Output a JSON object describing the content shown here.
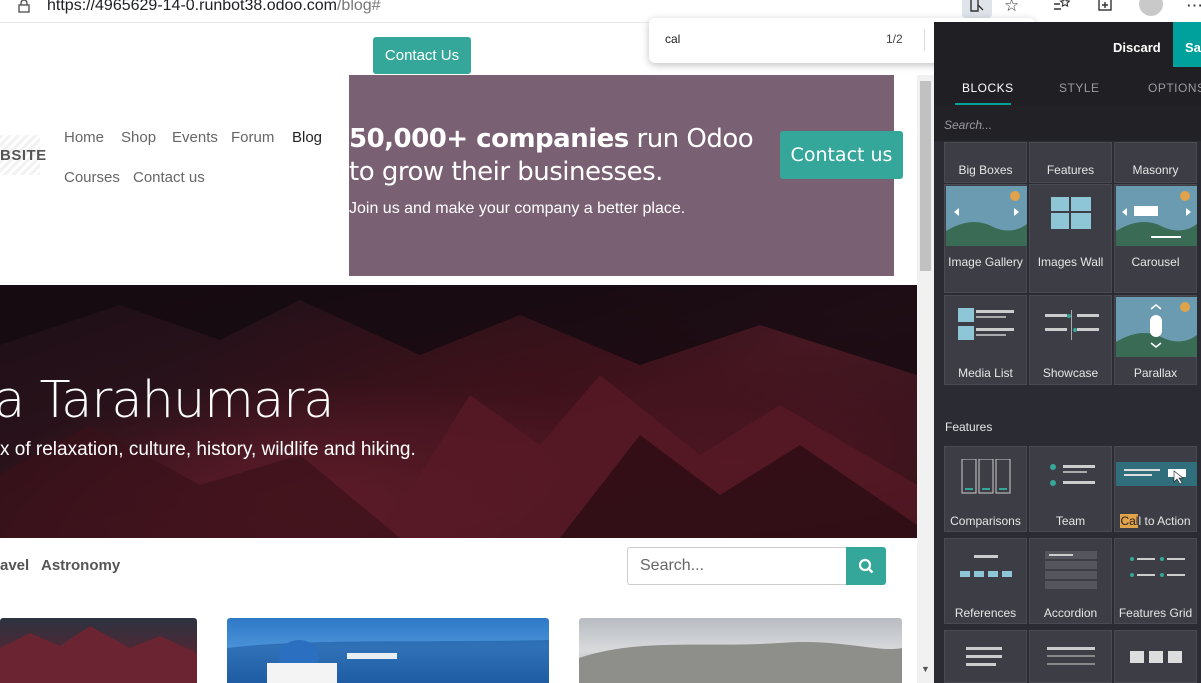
{
  "browser": {
    "url_main": "https://4965629-14-0.runbot38.odoo.com",
    "url_path": "/blog#"
  },
  "site": {
    "contact_top": "Contact Us",
    "logo": "BSITE",
    "nav": [
      "Home",
      "Shop",
      "Events",
      "Forum",
      "Blog",
      "Courses",
      "Contact us"
    ],
    "promo": {
      "title_bold": "50,000+ companies",
      "title_rest": " run Odoo to grow their businesses.",
      "subtitle": "Join us and make your company a better place.",
      "button": "Contact us"
    },
    "hero": {
      "title": "a Tarahumara",
      "subtitle": "x of relaxation, culture, history, wildlife and hiking."
    },
    "categories": [
      "avel",
      "Astronomy"
    ],
    "search_placeholder": "Search..."
  },
  "find": {
    "query": "cal",
    "count": "1/2"
  },
  "editor": {
    "discard": "Discard",
    "save": "Sa",
    "tabs": [
      "BLOCKS",
      "STYLE",
      "OPTIONS"
    ],
    "search_placeholder": "Search...",
    "top_row": [
      "Big Boxes",
      "Features",
      "Masonry"
    ],
    "row2": [
      "Image Gallery",
      "Images Wall",
      "Carousel"
    ],
    "row3": [
      "Media List",
      "Showcase",
      "Parallax"
    ],
    "features_section": "Features",
    "row4": [
      "Comparisons",
      "Team"
    ],
    "cta_highlight": "Cal",
    "cta_rest": "l to Action",
    "row5": [
      "References",
      "Accordion",
      "Features Grid"
    ]
  },
  "colors": {
    "accent": "#35a69a",
    "promo_bg": "#7a6073",
    "panel_bg": "#2b2b33",
    "save_bg": "#00a09d"
  }
}
